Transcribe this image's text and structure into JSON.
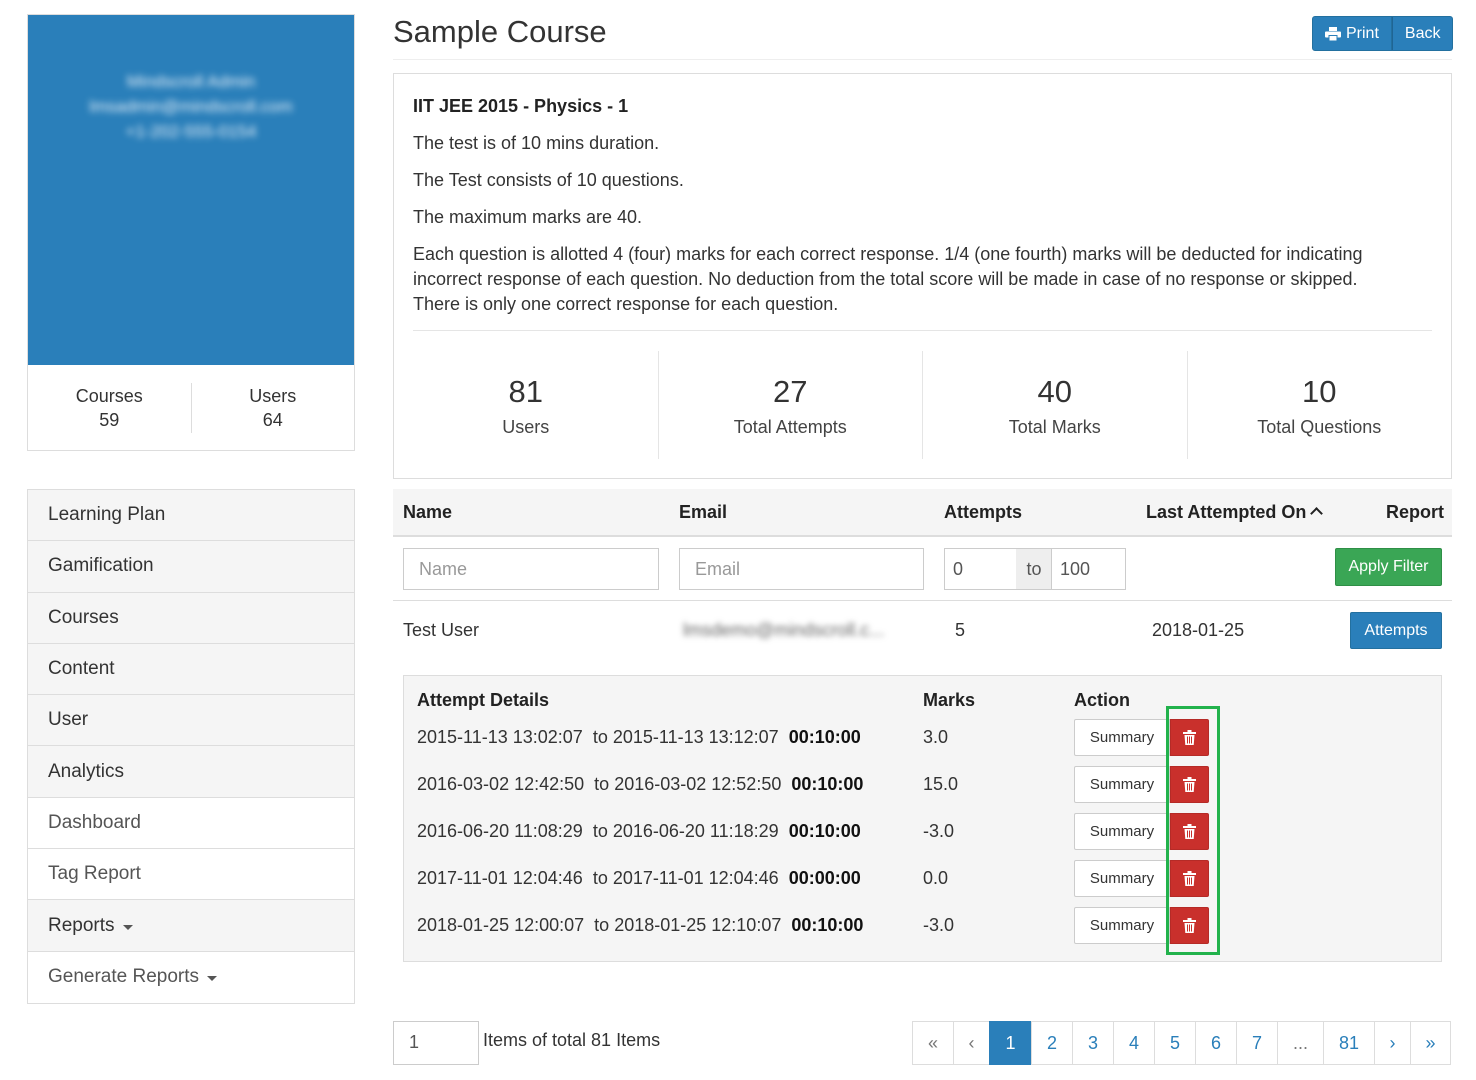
{
  "profile": {
    "name": "Mindscroll Admin",
    "email": "lmsadmin@mindscroll.com",
    "phone": "+1-202-555-0154",
    "stats": [
      {
        "label": "Courses",
        "value": "59"
      },
      {
        "label": "Users",
        "value": "64"
      }
    ]
  },
  "sidebar": {
    "items": [
      {
        "label": "Learning Plan"
      },
      {
        "label": "Gamification"
      },
      {
        "label": "Courses"
      },
      {
        "label": "Content"
      },
      {
        "label": "User"
      },
      {
        "label": "Analytics"
      },
      {
        "label": "Dashboard"
      },
      {
        "label": "Tag Report"
      },
      {
        "label": "Reports"
      },
      {
        "label": "Generate Reports"
      }
    ]
  },
  "header": {
    "title": "Sample Course",
    "print_label": "Print",
    "back_label": "Back"
  },
  "test_info": {
    "heading": "IIT JEE 2015 - Physics - 1",
    "lines": [
      "The test is of 10 mins duration.",
      "The Test consists of 10 questions.",
      "The maximum marks are 40.",
      "Each question is allotted 4 (four) marks for each correct response. 1/4 (one fourth) marks will be deducted for indicating incorrect response of each question. No deduction from the total score will be made in case of no response or skipped. There is only one correct response for each question."
    ],
    "stats": [
      {
        "value": "81",
        "label": "Users"
      },
      {
        "value": "27",
        "label": "Total Attempts"
      },
      {
        "value": "40",
        "label": "Total Marks"
      },
      {
        "value": "10",
        "label": "Total Questions"
      }
    ]
  },
  "table": {
    "headers": [
      "Name",
      "Email",
      "Attempts",
      "Last Attempted On",
      "Report"
    ],
    "filters": {
      "name_placeholder": "Name",
      "email_placeholder": "Email",
      "attempts_from": "0",
      "to_label": "to",
      "attempts_to": "100",
      "apply_label": "Apply Filter"
    },
    "rows": [
      {
        "name": "Test User",
        "email": "lmsdemo@mindscroll.c...",
        "attempts": "5",
        "last_attempted": "2018-01-25",
        "report_label": "Attempts"
      }
    ]
  },
  "attempt_details": {
    "headers": [
      "Attempt Details",
      "Marks",
      "Action"
    ],
    "to_word": "to",
    "summary_label": "Summary",
    "rows": [
      {
        "start": "2015-11-13 13:02:07",
        "end": "2015-11-13 13:12:07",
        "duration": "00:10:00",
        "marks": "3.0"
      },
      {
        "start": "2016-03-02 12:42:50",
        "end": "2016-03-02 12:52:50",
        "duration": "00:10:00",
        "marks": "15.0"
      },
      {
        "start": "2016-06-20 11:08:29",
        "end": "2016-06-20 11:18:29",
        "duration": "00:10:00",
        "marks": "-3.0"
      },
      {
        "start": "2017-11-01 12:04:46",
        "end": "2017-11-01 12:04:46",
        "duration": "00:00:00",
        "marks": "0.0"
      },
      {
        "start": "2018-01-25 12:00:07",
        "end": "2018-01-25 12:10:07",
        "duration": "00:10:00",
        "marks": "-3.0"
      }
    ]
  },
  "footer": {
    "page_size": "1",
    "items_text": "Items of total 81 Items"
  },
  "pagination": {
    "pages": [
      "«",
      "‹",
      "1",
      "2",
      "3",
      "4",
      "5",
      "6",
      "7",
      "...",
      "81",
      "›",
      "»"
    ],
    "active": "1"
  },
  "colors": {
    "primary": "#2a7fba",
    "success": "#3aa655",
    "danger": "#c9302c",
    "highlight": "#22b24c"
  }
}
